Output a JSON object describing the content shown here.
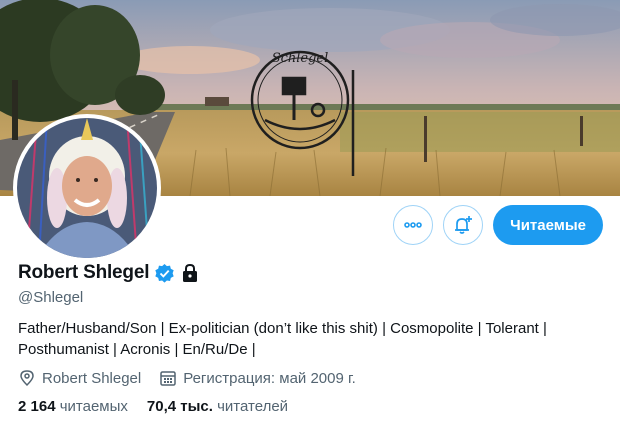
{
  "banner": {
    "sign_text": "Schlegel"
  },
  "actions": {
    "more_icon": "ellipsis-icon",
    "notify_icon": "bell-plus-icon",
    "follow_label": "Читаемые"
  },
  "profile": {
    "name": "Robert Shlegel",
    "handle": "@Shlegel",
    "verified_icon": "verified-badge-icon",
    "protected_icon": "lock-icon",
    "bio_line1": "Father/Husband/Son | Ex-politician (don’t like this shit) | Cosmopolite | Tolerant |",
    "bio_line2": "Posthumanist | Acronis | En/Ru/De |",
    "location_icon": "location-pin-icon",
    "location": "Robert Shlegel",
    "joined_icon": "calendar-icon",
    "joined": "Регистрация: май 2009 г."
  },
  "stats": {
    "following_count": "2 164",
    "following_label": "читаемых",
    "followers_count": "70,4 тыс.",
    "followers_label": "читателей"
  },
  "colors": {
    "accent": "#1d9bf0",
    "secondary_text": "#536471",
    "primary_text": "#0f1419"
  }
}
